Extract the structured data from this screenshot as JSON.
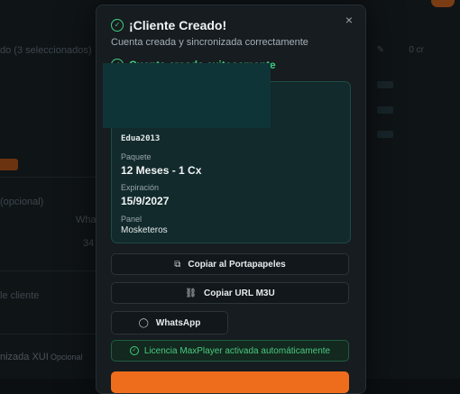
{
  "modal": {
    "title": "¡Cliente Creado!",
    "subtitle": "Cuenta creada y sincronizada correctamente",
    "success_message": "Cuenta creada exitosamente",
    "close_symbol": "×"
  },
  "account": {
    "username": "Edua2013",
    "package_label": "Paquete",
    "package_value": "12 Meses - 1 Cx",
    "expiration_label": "Expiración",
    "expiration_value": "15/9/2027",
    "panel_label": "Panel",
    "panel_value": "Mosketeros"
  },
  "actions": {
    "copy_clipboard": "Copiar al Portapapeles",
    "copy_m3u": "Copiar URL M3U",
    "whatsapp": "WhatsApp"
  },
  "license_notice": "Licencia MaxPlayer activada automáticamente",
  "background": {
    "selection_heading": "do (3 seleccionados)",
    "right_value": "0 cr",
    "optional_label": "(opcional)",
    "whatsapp_partial": "Whats",
    "number_partial": "34",
    "client_partial": "le cliente",
    "xui_partial": "nizada XUI",
    "opcional_tag": "Opcional"
  },
  "colors": {
    "accent_green": "#3fcf7e",
    "accent_orange": "#ee6d1c",
    "card_bg": "#122a2b"
  },
  "icons": {
    "success": "check-circle-icon",
    "copy": "copy-icon",
    "link": "link-icon",
    "whatsapp": "chat-bubble-icon",
    "close": "close-icon"
  }
}
